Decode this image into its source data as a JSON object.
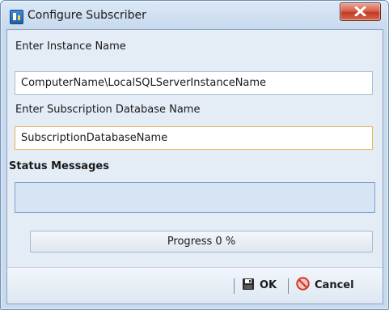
{
  "window": {
    "title": "Configure Subscriber",
    "icons": {
      "app": "sql-server-icon",
      "close": "close-x-icon"
    }
  },
  "instance": {
    "label": "Enter Instance Name",
    "value": "ComputerName\\LocalSQLServerInstanceName"
  },
  "database": {
    "label": "Enter Subscription Database Name",
    "value": "SubscriptionDatabaseName"
  },
  "status": {
    "label": "Status Messages",
    "text": ""
  },
  "progress": {
    "text": "Progress 0 %",
    "value": 0
  },
  "footer": {
    "ok_label": "OK",
    "cancel_label": "Cancel",
    "icons": {
      "ok": "save-floppy-icon",
      "cancel": "cancel-no-icon"
    }
  },
  "colors": {
    "title_bar": "#c8daee",
    "close_button": "#c13b24",
    "panel_background": "#e4ecf6",
    "status_box": "#d6e4f3"
  }
}
